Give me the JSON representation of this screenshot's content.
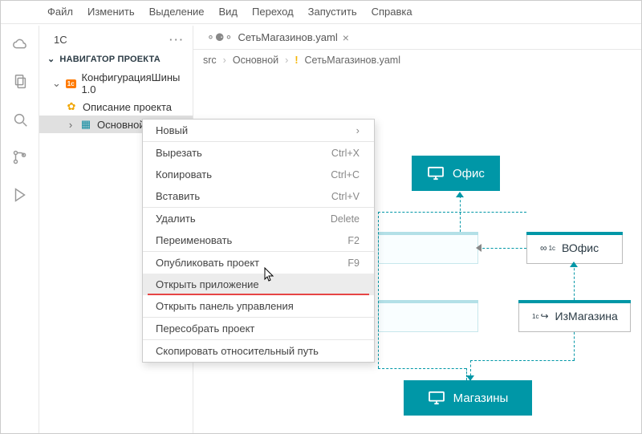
{
  "menu": {
    "items": [
      "Файл",
      "Изменить",
      "Выделение",
      "Вид",
      "Переход",
      "Запустить",
      "Справка"
    ]
  },
  "sidebar": {
    "header": "1С",
    "nav_title": "НАВИГАТОР ПРОЕКТА",
    "tree": {
      "root": "КонфигурацияШины 1.0",
      "child_desc": "Описание проекта",
      "child_main": "Основной"
    }
  },
  "tab": {
    "label": "СетьМагазинов.yaml"
  },
  "crumbs": {
    "a": "src",
    "b": "Основной",
    "c": "СетьМагазинов.yaml"
  },
  "diagram": {
    "office": "Офис",
    "in_office": "ВОфис",
    "from_store": "ИзМагазина",
    "stores": "Магазины"
  },
  "context_menu": {
    "new": "Новый",
    "cut": "Вырезать",
    "cut_k": "Ctrl+X",
    "copy": "Копировать",
    "copy_k": "Ctrl+C",
    "paste": "Вставить",
    "paste_k": "Ctrl+V",
    "delete": "Удалить",
    "delete_k": "Delete",
    "rename": "Переименовать",
    "rename_k": "F2",
    "publish": "Опубликовать проект",
    "publish_k": "F9",
    "open_app": "Открыть приложение",
    "open_panel": "Открыть панель управления",
    "rebuild": "Пересобрать проект",
    "copy_path": "Скопировать относительный путь"
  }
}
